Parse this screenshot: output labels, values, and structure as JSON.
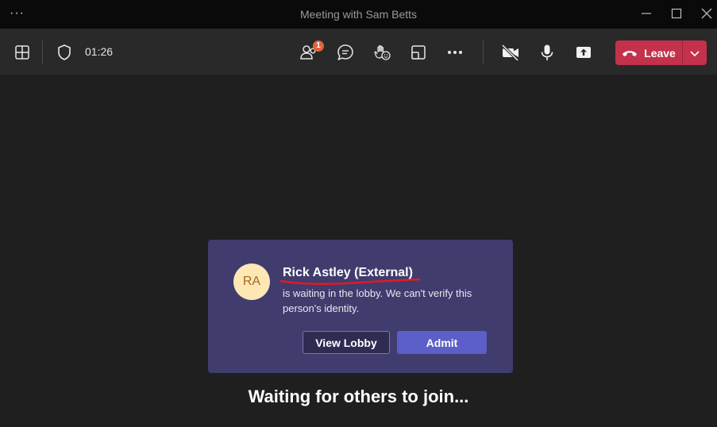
{
  "window": {
    "title": "Meeting with Sam Betts",
    "menu_label": "···"
  },
  "toolbar": {
    "timer": "01:26",
    "participants_badge": "1",
    "leave_label": "Leave",
    "icons": [
      "layout-icon",
      "shield-icon",
      "participants-icon",
      "chat-icon",
      "raise-hand-icon",
      "share-tray-icon",
      "more-options-icon",
      "camera-off-icon",
      "microphone-icon",
      "share-screen-icon",
      "phone-hangup-icon",
      "chevron-down-icon"
    ]
  },
  "lobby_card": {
    "avatar_initials": "RA",
    "person_name": "Rick Astley (External)",
    "message": "is waiting in the lobby. We can't verify this person's identity.",
    "view_lobby_label": "View Lobby",
    "admit_label": "Admit"
  },
  "stage": {
    "status_text": "Waiting for others to join..."
  },
  "colors": {
    "background": "#1f1f1f",
    "toolbar": "#292929",
    "leave": "#c4314b",
    "card": "#403c6e",
    "admit": "#5b5fc7",
    "avatar_bg": "#fde7b5",
    "annotation_underline": "#e01b24",
    "badge": "#e0663a"
  }
}
